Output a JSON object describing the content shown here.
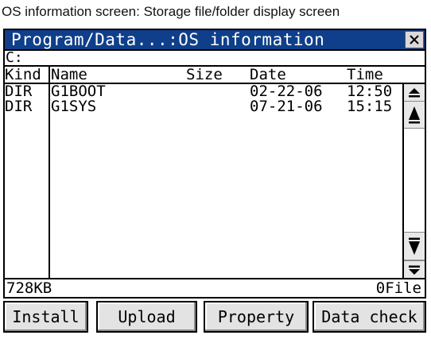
{
  "caption": "OS information screen: Storage file/folder display screen",
  "window": {
    "title": "Program/Data...:OS information",
    "close_glyph": "×",
    "drive": "C:"
  },
  "columns": {
    "kind": "Kind",
    "name": "Name",
    "size": "Size",
    "date": "Date",
    "time": "Time"
  },
  "files": [
    {
      "kind": "DIR",
      "name": "G1BOOT",
      "size": "",
      "date": "02-22-06",
      "time": "12:50"
    },
    {
      "kind": "DIR",
      "name": "G1SYS",
      "size": "",
      "date": "07-21-06",
      "time": "15:15"
    }
  ],
  "scrollbar": {
    "top_icon": "scroll-to-top-icon",
    "up_icon": "page-up-icon",
    "down_icon": "page-down-icon",
    "bottom_icon": "scroll-to-bottom-icon"
  },
  "status": {
    "free_space": "728KB",
    "file_count": "0File"
  },
  "buttons": {
    "install": "Install",
    "upload": "Upload",
    "property": "Property",
    "data_check": "Data check"
  },
  "colors": {
    "titlebar": "#0f3f8a",
    "button_face": "#e3e3e3"
  }
}
